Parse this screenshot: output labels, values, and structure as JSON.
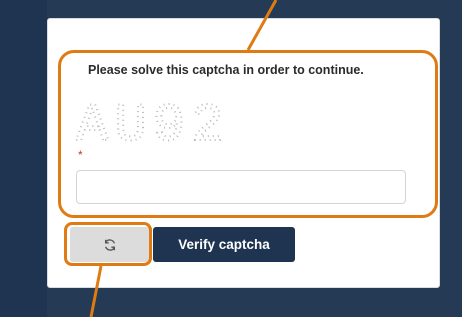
{
  "captcha": {
    "prompt": "Please solve this captcha in order to continue.",
    "image_text": "AU92",
    "required_marker": "*",
    "input_value": "",
    "input_placeholder": ""
  },
  "buttons": {
    "refresh_icon": "refresh-icon",
    "verify_label": "Verify captcha"
  },
  "colors": {
    "page_background": "#243a55",
    "card": "#ffffff",
    "highlight": "#e07a12",
    "primary_button": "#1f3450",
    "secondary_button": "#dcdcdc"
  }
}
